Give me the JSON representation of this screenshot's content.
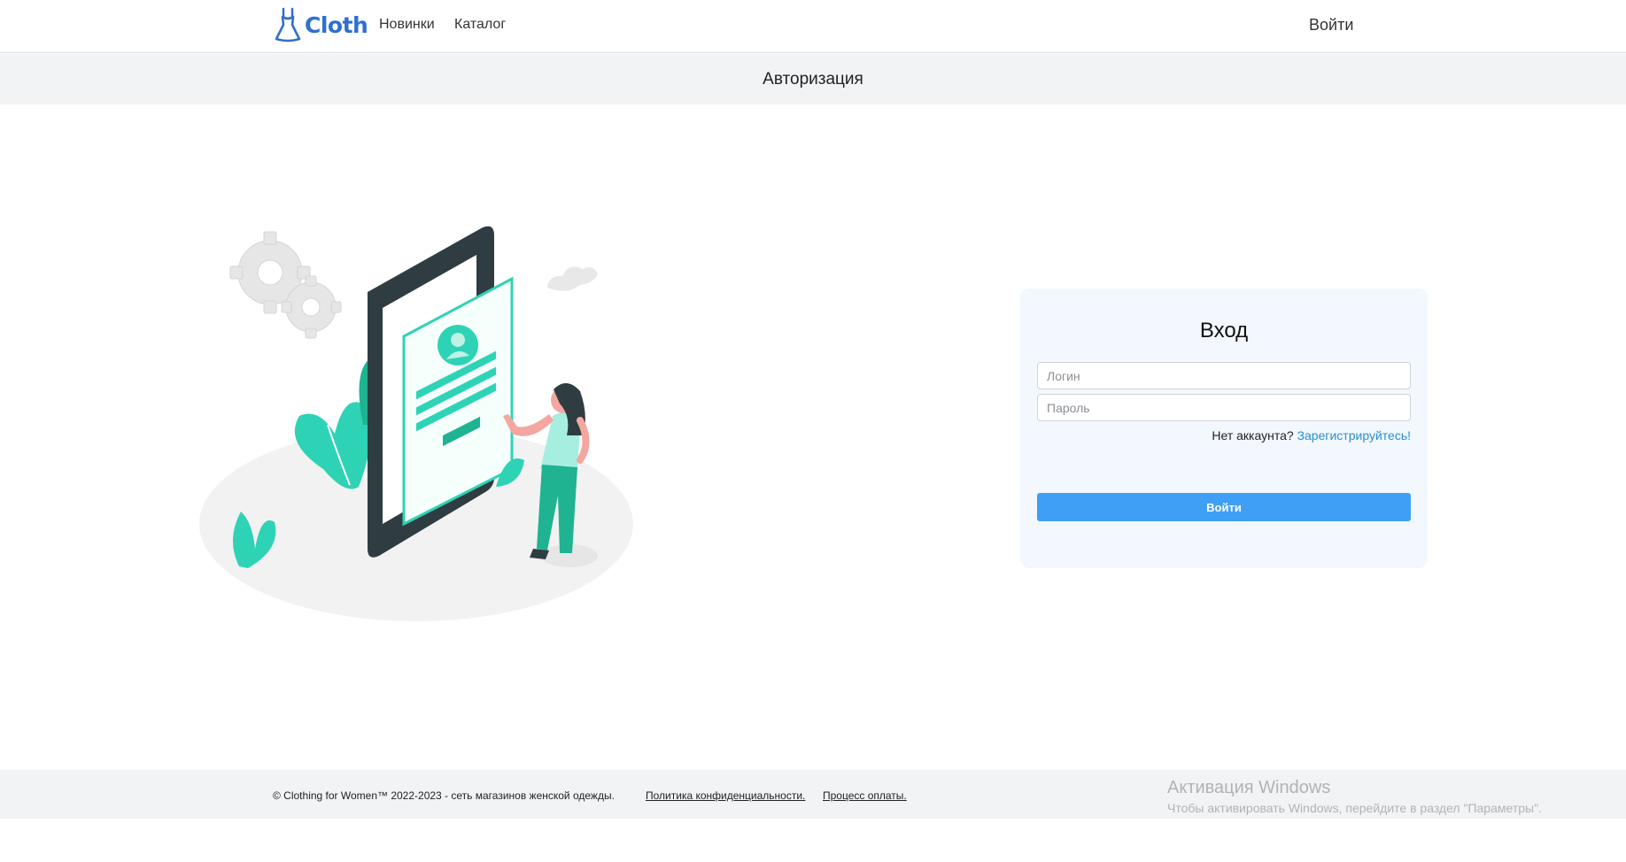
{
  "navbar": {
    "logo_text": "Cloth",
    "links": [
      {
        "label": "Новинки"
      },
      {
        "label": "Каталог"
      }
    ],
    "login_label": "Войти"
  },
  "page_title": "Авторизация",
  "login_form": {
    "title": "Вход",
    "login_placeholder": "Логин",
    "password_placeholder": "Пароль",
    "no_account_text": "Нет аккаунта?",
    "register_link": "Зарегистрируйтесь!",
    "submit_label": "Войти"
  },
  "footer": {
    "copyright": "© Clothing for Women™ 2022-2023 - сеть магазинов женской одежды.",
    "privacy_link": "Политика конфиденциальности.",
    "payment_link": "Процесс оплаты."
  },
  "watermark": {
    "title": "Активация Windows",
    "subtitle": "Чтобы активировать Windows, перейдите в раздел \"Параметры\"."
  },
  "colors": {
    "accent": "#3f9ff5",
    "logo": "#2f6fd0",
    "illustration_teal": "#2ed3b5",
    "phone_dark": "#2f3d42"
  }
}
